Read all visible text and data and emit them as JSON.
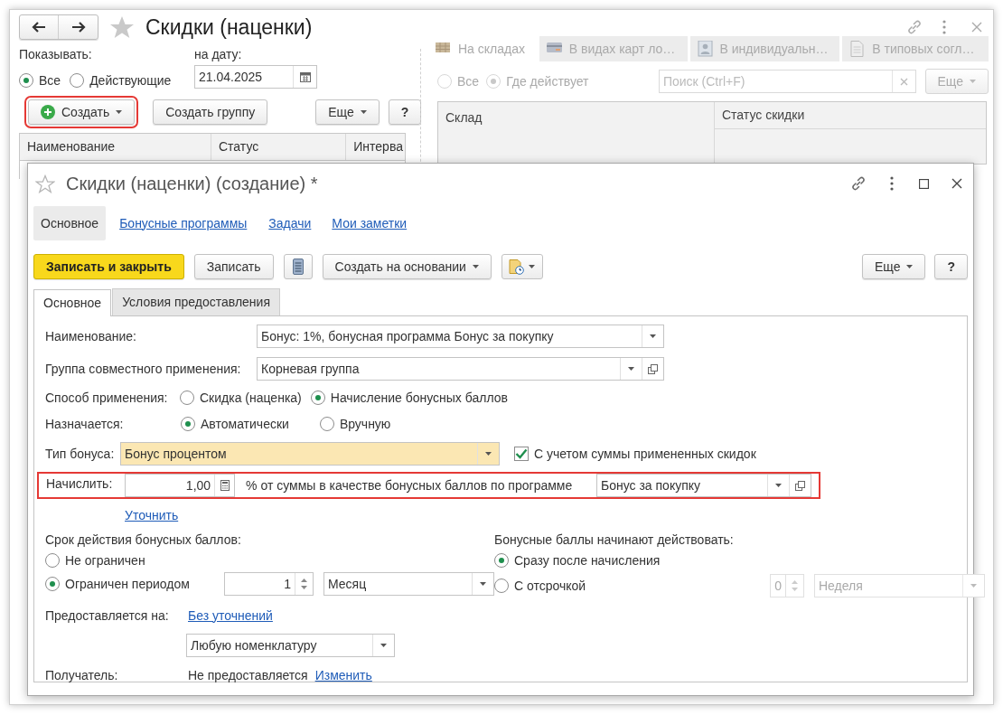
{
  "main_window": {
    "title": "Скидки (наценки)",
    "filter": {
      "label": "Показывать:",
      "options": [
        {
          "label": "Все",
          "selected": true
        },
        {
          "label": "Действующие",
          "selected": false
        }
      ],
      "date_label": "на дату:",
      "date": "21.04.2025"
    },
    "toolbar": [
      {
        "label": "Создать",
        "kind": "create",
        "highlighted": true
      },
      {
        "label": "Создать группу",
        "kind": "plain",
        "highlighted": false
      },
      {
        "label": "Еще",
        "kind": "menu",
        "highlighted": false
      },
      {
        "label": "?",
        "kind": "help",
        "highlighted": false
      }
    ],
    "table": {
      "columns": [
        "Наименование",
        "Статус",
        "Интерва"
      ]
    },
    "right_panel": {
      "disabled": true,
      "tabs": [
        {
          "label": "На складах",
          "selected": true
        },
        {
          "label": "В видах карт ло…",
          "selected": false
        },
        {
          "label": "В индивидуальн…",
          "selected": false
        },
        {
          "label": "В типовых согл…",
          "selected": false
        }
      ],
      "options": [
        {
          "label": "Все",
          "selected": false
        },
        {
          "label": "Где действует",
          "selected": true
        }
      ],
      "search": {
        "placeholder": "Поиск (Ctrl+F)"
      },
      "more": "Еще",
      "table": {
        "columns": [
          "Склад",
          "Статус скидки"
        ]
      }
    }
  },
  "dialog": {
    "title": "Скидки (наценки) (создание) *",
    "sections": [
      {
        "label": "Основное",
        "selected": true
      },
      {
        "label": "Бонусные программы",
        "selected": false
      },
      {
        "label": "Задачи",
        "selected": false
      },
      {
        "label": "Мои заметки",
        "selected": false
      }
    ],
    "toolbar": [
      {
        "kind": "primary",
        "label": "Записать и закрыть"
      },
      {
        "kind": "plain",
        "label": "Записать"
      },
      {
        "kind": "list"
      },
      {
        "kind": "menu",
        "label": "Создать на основании"
      },
      {
        "kind": "report"
      }
    ],
    "toolbar_right": [
      {
        "kind": "menu",
        "label": "Еще"
      },
      {
        "kind": "help",
        "label": "?"
      }
    ],
    "tabs": [
      {
        "label": "Основное",
        "selected": true
      },
      {
        "label": "Условия предоставления",
        "selected": false
      }
    ],
    "form": {
      "name": {
        "label": "Наименование:",
        "value": "Бонус: 1%, бонусная программа Бонус за покупку"
      },
      "group": {
        "label": "Группа совместного применения:",
        "value": "Корневая группа"
      },
      "method": {
        "label": "Способ применения:",
        "options": [
          {
            "label": "Скидка (наценка)",
            "selected": false
          },
          {
            "label": "Начисление бонусных баллов",
            "selected": true
          }
        ]
      },
      "assign": {
        "label": "Назначается:",
        "options": [
          {
            "label": "Автоматически",
            "selected": true
          },
          {
            "label": "Вручную",
            "selected": false
          }
        ]
      },
      "bonus_type": {
        "label": "Тип бонуса:",
        "value": "Бонус процентом",
        "checkbox": {
          "label": "С учетом суммы примененных скидок",
          "checked": true
        }
      },
      "accrue": {
        "label": "Начислить:",
        "value": "1,00",
        "text": "% от суммы в качестве бонусных баллов по программе",
        "program": "Бонус за покупку",
        "highlighted": true
      },
      "refine_link": "Уточнить",
      "validity": {
        "label": "Срок действия бонусных баллов:",
        "options": [
          {
            "label": "Не ограничен",
            "selected": false
          },
          {
            "label": "Ограничен периодом",
            "selected": true
          }
        ],
        "count": "1",
        "unit": "Месяц"
      },
      "start": {
        "label": "Бонусные баллы начинают действовать:",
        "options": [
          {
            "label": "Сразу после начисления",
            "selected": true
          },
          {
            "label": "С отсрочкой",
            "selected": false
          }
        ],
        "count": "0",
        "unit": "Неделя",
        "disabled": true
      },
      "applies_to": {
        "label": "Предоставляется на:",
        "link": "Без уточнений",
        "value": "Любую номенклатуру"
      },
      "recipient": {
        "label": "Получатель:",
        "value": "Не предоставляется",
        "link": "Изменить"
      }
    }
  }
}
